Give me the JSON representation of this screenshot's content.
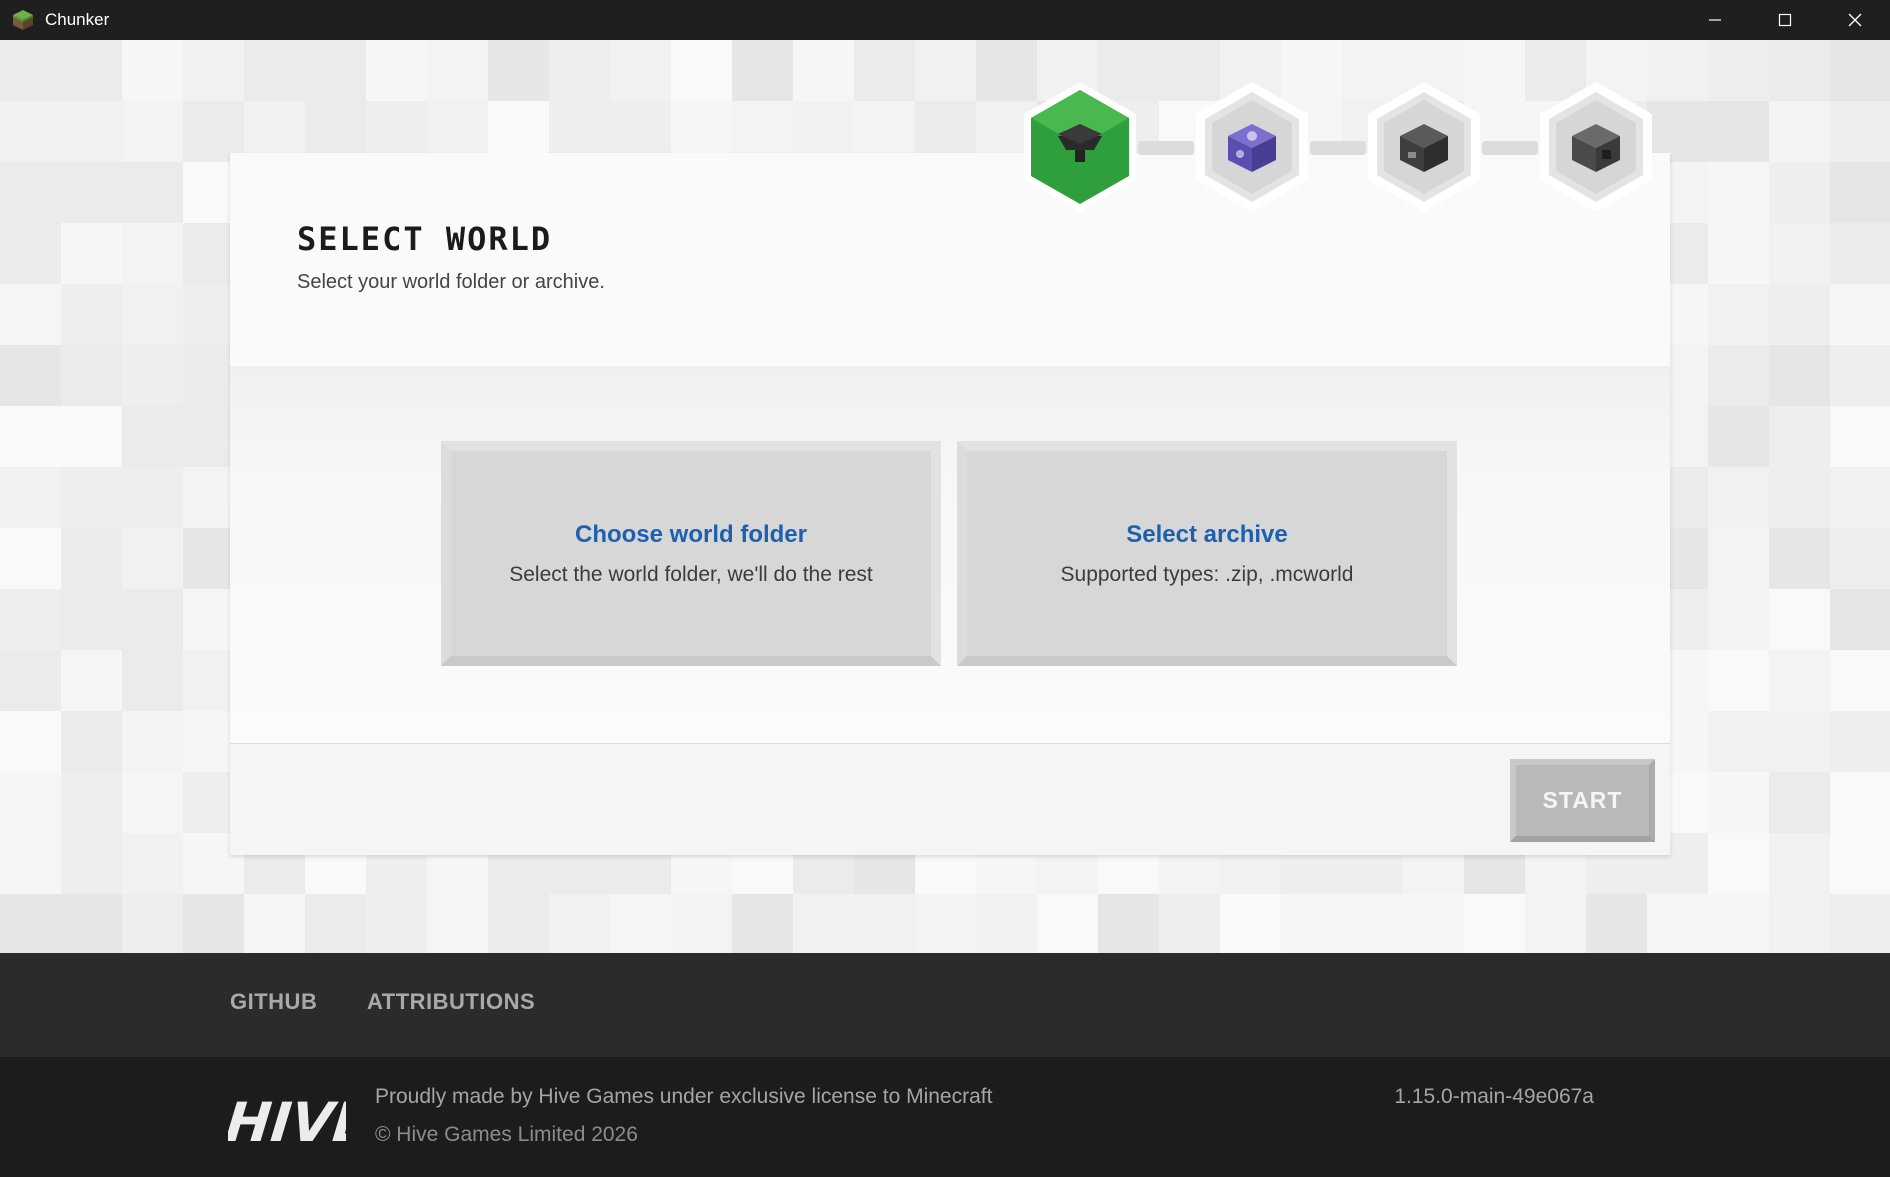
{
  "window": {
    "title": "Chunker",
    "app_icon": "grass-block-icon",
    "controls": [
      "minimize-icon",
      "maximize-icon",
      "close-icon"
    ]
  },
  "steps": [
    {
      "icon": "hopper-icon",
      "state": "active",
      "color": "#3fae49"
    },
    {
      "icon": "command-block-icon",
      "state": "inactive"
    },
    {
      "icon": "chest-icon",
      "state": "inactive"
    },
    {
      "icon": "dispenser-icon",
      "state": "inactive"
    }
  ],
  "header": {
    "title": "SELECT WORLD",
    "subtitle": "Select your world folder or archive."
  },
  "options": {
    "folder": {
      "title": "Choose world folder",
      "description": "Select the world folder, we'll do the rest"
    },
    "archive": {
      "title": "Select archive",
      "description": "Supported types: .zip, .mcworld"
    }
  },
  "actions": {
    "start_label": "START"
  },
  "footer": {
    "links": [
      "GITHUB",
      "ATTRIBUTIONS"
    ],
    "logo_text": "HIVE",
    "made_by": "Proudly made by Hive Games under exclusive license to Minecraft",
    "copyright": "© Hive Games Limited 2026",
    "version": "1.15.0-main-49e067a"
  },
  "colors": {
    "accent_green": "#3fae49",
    "link_blue": "#1d5fb0",
    "titlebar": "#1f1f20",
    "footer": "#2b2b2c"
  }
}
